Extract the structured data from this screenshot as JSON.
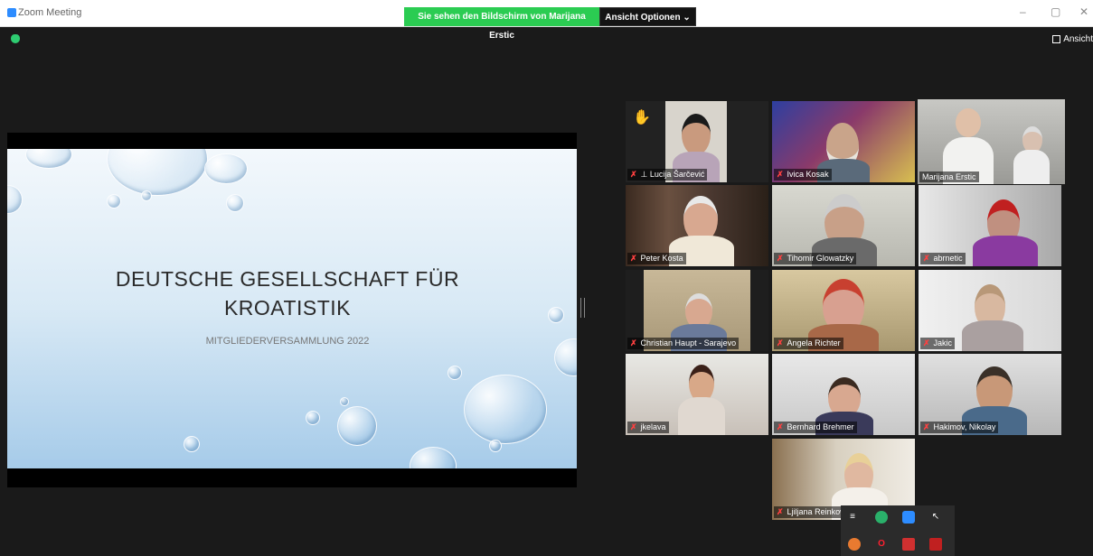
{
  "window": {
    "title": "Zoom Meeting",
    "minimize": "–",
    "restore": "▢",
    "close": "✕"
  },
  "share_banner": "Sie sehen den Bildschirm von Marijana Erstic",
  "view_options": "Ansicht Optionen ⌄",
  "view_toggle": "Ansicht",
  "slide": {
    "title_line1": "DEUTSCHE GESELLSCHAFT FÜR",
    "title_line2": "KROATISTIK",
    "subtitle": "MITGLIEDERVERSAMMLUNG 2022"
  },
  "participants": [
    {
      "name": "Lucija Šarčević",
      "muted": true,
      "pinned": true,
      "hand_raised": true
    },
    {
      "name": "Ivica Kosak",
      "muted": true
    },
    {
      "name": "Marijana Erstic",
      "muted": false,
      "active_speaker": true
    },
    {
      "name": "Peter Kosta",
      "muted": true
    },
    {
      "name": "Tihomir Glowatzky",
      "muted": true
    },
    {
      "name": "abrnetic",
      "muted": true
    },
    {
      "name": "Christian Haupt - Sarajevo",
      "muted": true
    },
    {
      "name": "Angela Richter",
      "muted": true
    },
    {
      "name": "Jakic",
      "muted": true
    },
    {
      "name": "jkelava",
      "muted": true
    },
    {
      "name": "Bernhard Brehmer",
      "muted": true
    },
    {
      "name": "Hakimov, Nikolay",
      "muted": true
    },
    {
      "name": "Ljiljana Reinkowski",
      "muted": true
    }
  ],
  "icons": {
    "mic_muted": "✗",
    "pin": "⊥",
    "hand": "✋"
  },
  "colors": {
    "share_banner": "#2bcc52",
    "active_speaker_border": "#cde55a",
    "muted_icon": "#ff4040"
  }
}
